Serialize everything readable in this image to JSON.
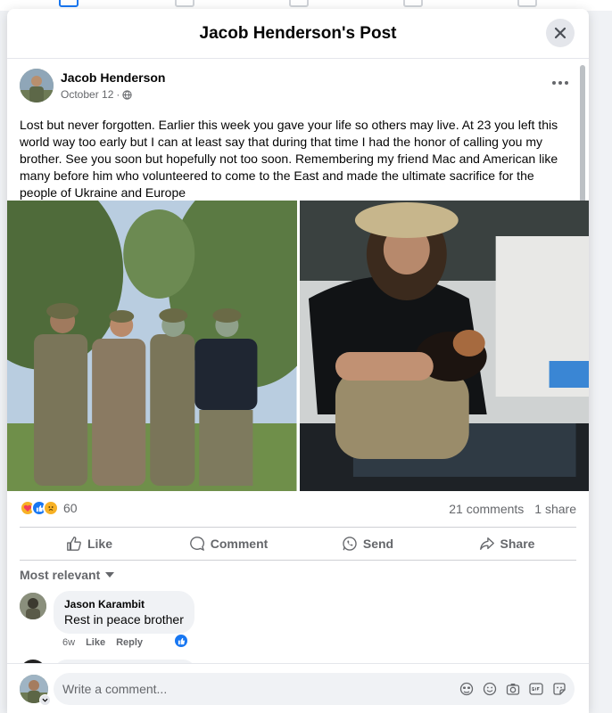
{
  "modal": {
    "title": "Jacob Henderson's Post"
  },
  "post": {
    "author": "Jacob Henderson",
    "date": "October 12",
    "separator": "·",
    "text": "Lost but never forgotten. Earlier this week you gave your life so others may live. At 23 you left this world way too early but I can at least say that during that time I had the honor of calling you my brother. See you soon but hopefully not too soon. Remembering my friend Mac and American like many before him who volunteered to come to the East and made the ultimate sacrifice for the people of Ukraine and Europe"
  },
  "reactions": {
    "icons": [
      "care",
      "like",
      "sad"
    ],
    "count": "60"
  },
  "stats": {
    "comments": "21 comments",
    "shares": "1 share"
  },
  "actions": {
    "like": "Like",
    "comment": "Comment",
    "send": "Send",
    "share": "Share"
  },
  "comments": {
    "sort_label": "Most relevant",
    "items": [
      {
        "author": "Jason Karambit",
        "text": "Rest in peace brother",
        "time": "6w",
        "like": "Like",
        "reply": "Reply"
      }
    ]
  },
  "composer": {
    "placeholder": "Write a comment..."
  },
  "colors": {
    "accent": "#1877f2",
    "muted_text": "#65676b",
    "care": "#f7b125",
    "sad": "#f7b125"
  }
}
